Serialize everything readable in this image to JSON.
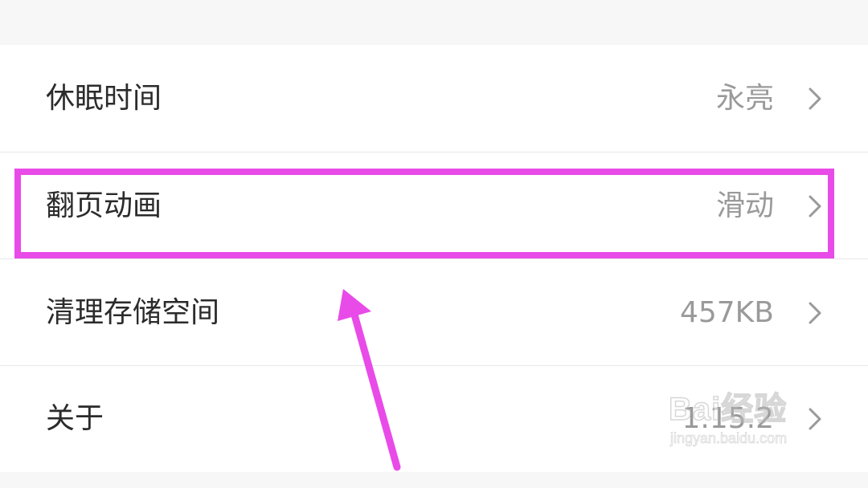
{
  "settings": {
    "rows": [
      {
        "label": "休眠时间",
        "value": "永亮"
      },
      {
        "label": "翻页动画",
        "value": "滑动"
      },
      {
        "label": "清理存储空间",
        "value": "457KB"
      },
      {
        "label": "关于",
        "value": "1.15.2"
      }
    ]
  },
  "annotation": {
    "color": "#e84be8",
    "highlighted_row": "翻页动画"
  },
  "watermark": {
    "logo_text": "Bai经验",
    "url_text": "jingyan.baidu.com"
  },
  "icons": {
    "chevron": "chevron-right-icon",
    "arrow": "annotation-arrow-icon"
  }
}
